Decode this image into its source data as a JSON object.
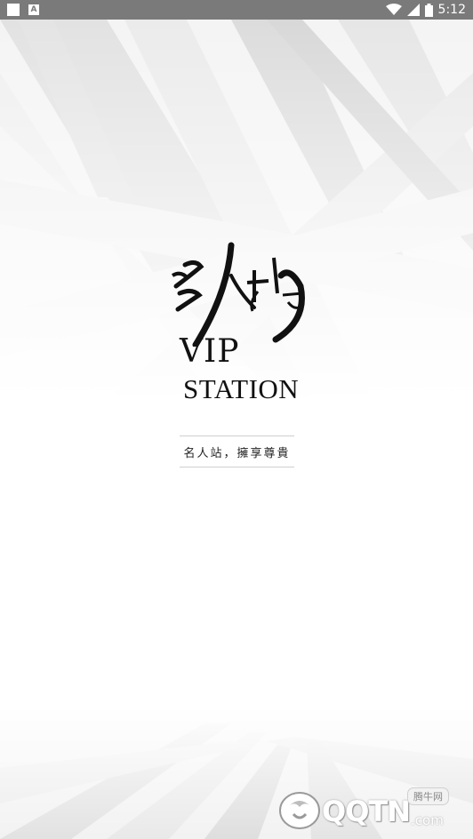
{
  "status_bar": {
    "time": "5:12",
    "left_icons": [
      "white-square-icon",
      "a-notification-icon"
    ],
    "right_icons": [
      "wifi-icon",
      "cellular-signal-icon",
      "battery-icon"
    ]
  },
  "logo": {
    "chinese_mark": "名人站",
    "line1": "VIP",
    "line2": "STATION"
  },
  "tagline": "名人站，擁享尊貴",
  "watermark": {
    "badge": "腾牛网",
    "brand": "QQTN",
    "domain": ".com"
  }
}
